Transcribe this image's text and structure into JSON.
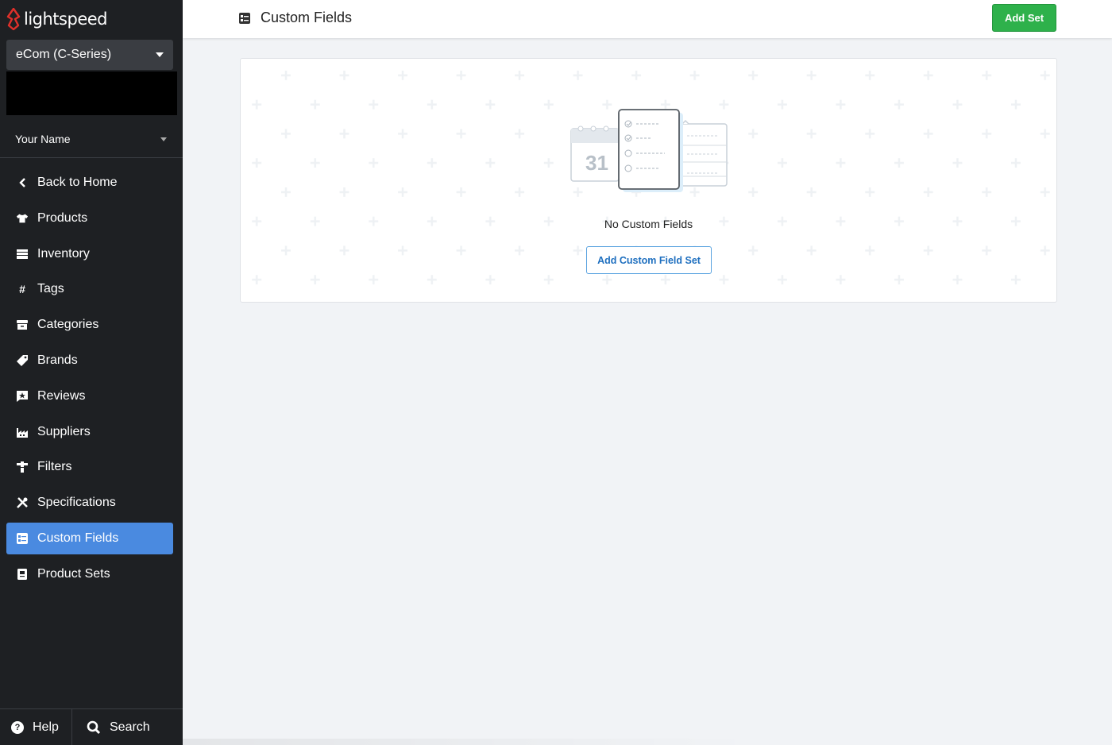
{
  "brand": {
    "name": "lightspeed",
    "logo_color": "#e0302a"
  },
  "store_selector": {
    "value": "eCom (C-Series)"
  },
  "user": {
    "name": "Your Name"
  },
  "nav": {
    "items": [
      {
        "label": "Back to Home",
        "icon": "chevron-left-icon"
      },
      {
        "label": "Products",
        "icon": "shirt-icon"
      },
      {
        "label": "Inventory",
        "icon": "inventory-icon"
      },
      {
        "label": "Tags",
        "icon": "hash-icon"
      },
      {
        "label": "Categories",
        "icon": "archive-icon"
      },
      {
        "label": "Brands",
        "icon": "tag-icon"
      },
      {
        "label": "Reviews",
        "icon": "star-comment-icon"
      },
      {
        "label": "Suppliers",
        "icon": "factory-icon"
      },
      {
        "label": "Filters",
        "icon": "filter-icon"
      },
      {
        "label": "Specifications",
        "icon": "tools-icon"
      },
      {
        "label": "Custom Fields",
        "icon": "custom-fields-icon",
        "active": true
      },
      {
        "label": "Product Sets",
        "icon": "product-sets-icon"
      }
    ],
    "active_color": "#4a8ae0"
  },
  "footer": {
    "help_label": "Help",
    "search_label": "Search"
  },
  "header": {
    "title": "Custom Fields",
    "add_set_label": "Add Set",
    "add_set_color": "#2eb14b"
  },
  "empty_state": {
    "calendar_day": "31",
    "message": "No Custom Fields",
    "button_label": "Add Custom Field Set"
  }
}
